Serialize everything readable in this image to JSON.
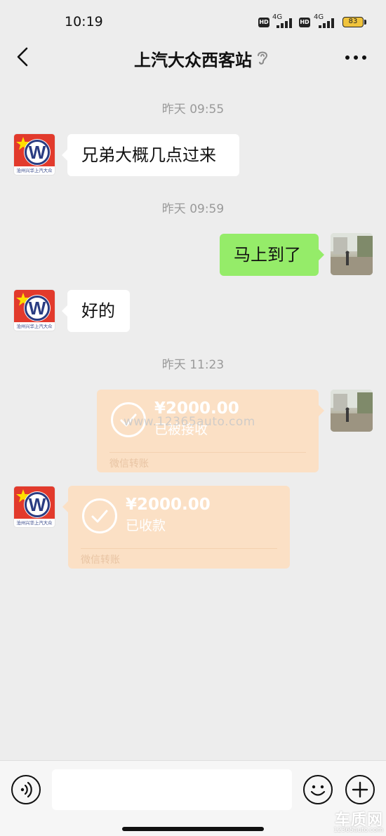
{
  "status_bar": {
    "time": "10:19",
    "sim1_badge": "HD",
    "sim1_network": "4G",
    "sim2_badge": "HD",
    "sim2_network": "4G",
    "battery": "83",
    "icons": [
      "signal-icon",
      "battery-icon"
    ]
  },
  "header": {
    "title": "上汽大众西客站",
    "icons": [
      "back-arrow-icon",
      "ear-icon",
      "more-icon"
    ]
  },
  "messages": [
    {
      "type": "timestamp",
      "text": "昨天 09:55"
    },
    {
      "type": "text",
      "side": "in",
      "text": "兄弟大概几点过来"
    },
    {
      "type": "timestamp",
      "text": "昨天 09:59"
    },
    {
      "type": "text",
      "side": "out",
      "text": "马上到了"
    },
    {
      "type": "text",
      "side": "in",
      "text": "好的"
    },
    {
      "type": "timestamp",
      "text": "昨天 11:23"
    },
    {
      "type": "transfer",
      "side": "out",
      "amount": "¥2000.00",
      "status": "已被接收",
      "footer": "微信转账"
    },
    {
      "type": "transfer",
      "side": "in",
      "amount": "¥2000.00",
      "status": "已收款",
      "footer": "微信转账"
    }
  ],
  "contact_avatar": {
    "caption": "沧州兴华上汽大众",
    "logo_letter": "W"
  },
  "watermark": {
    "url": "www.12365auto.com",
    "logo_text": "车质网",
    "logo_url": "12365auto.com"
  },
  "colors": {
    "background": "#ededed",
    "outgoing_bubble": "#95ec69",
    "incoming_bubble": "#ffffff",
    "transfer_card": "#fbe0c5",
    "timestamp_text": "#9a9a9a"
  },
  "input_bar": {
    "icons": [
      "voice-icon",
      "emoji-icon",
      "plus-icon"
    ],
    "input_value": ""
  }
}
